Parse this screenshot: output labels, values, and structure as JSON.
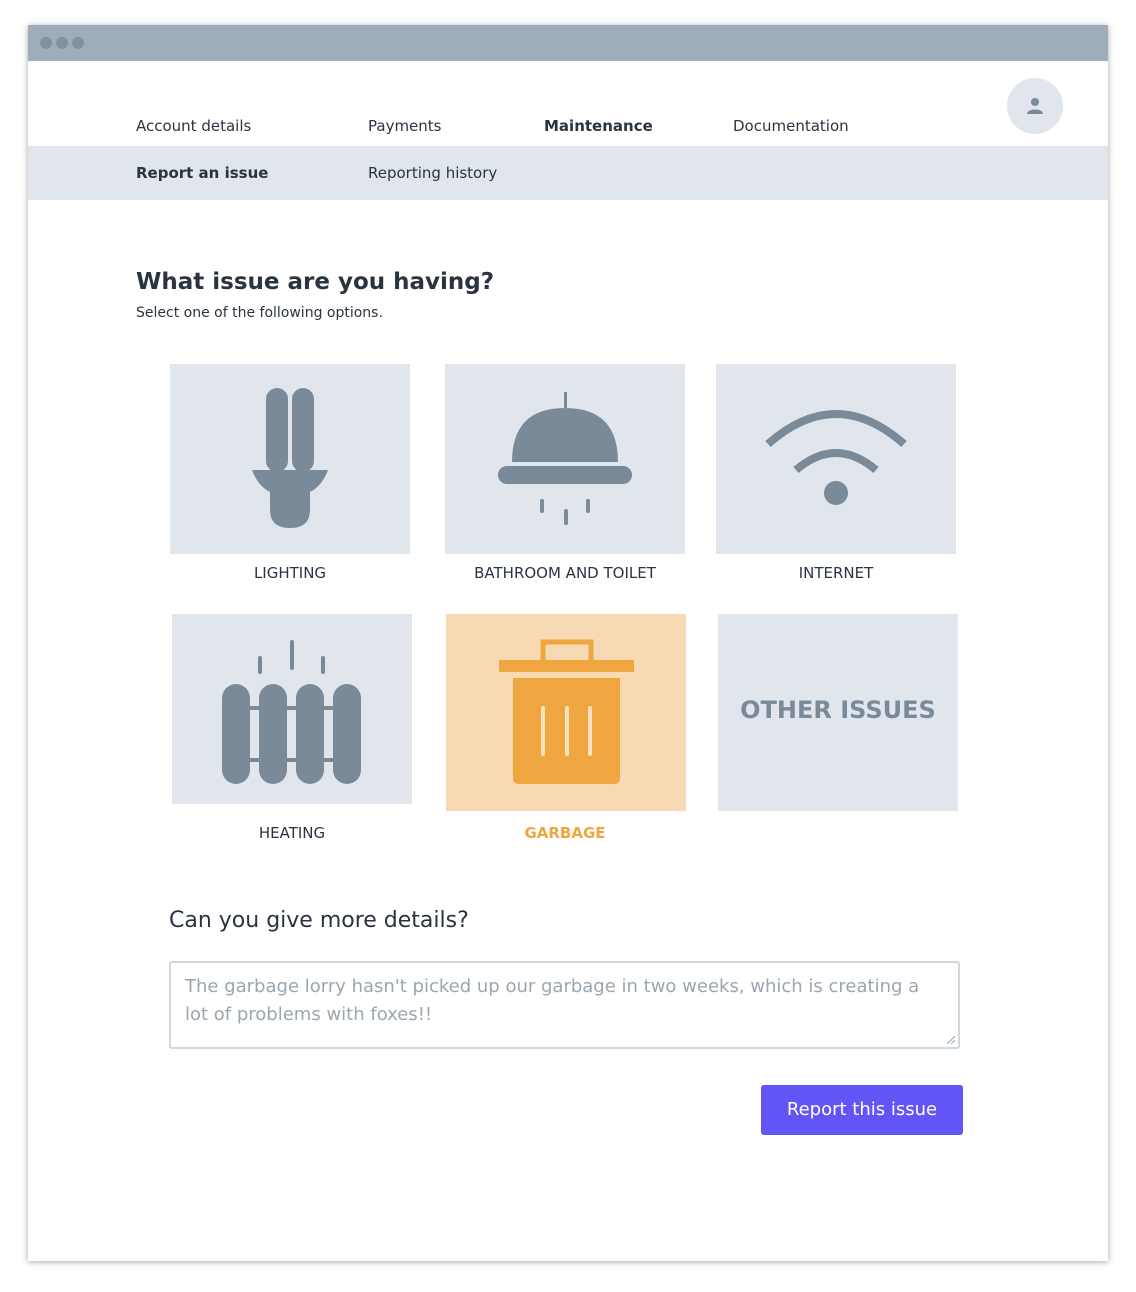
{
  "nav": {
    "items": [
      {
        "label": "Account details",
        "active": false
      },
      {
        "label": "Payments",
        "active": false
      },
      {
        "label": "Maintenance",
        "active": true
      },
      {
        "label": "Documentation",
        "active": false
      }
    ],
    "avatar_icon": "user-icon"
  },
  "subnav": {
    "items": [
      {
        "label": "Report an issue",
        "active": true
      },
      {
        "label": "Reporting history",
        "active": false
      }
    ]
  },
  "main": {
    "heading": "What issue are you having?",
    "subheading": "Select one of the following options.",
    "options": [
      {
        "label": "LIGHTING",
        "icon": "lightbulb-icon",
        "selected": false
      },
      {
        "label": "BATHROOM AND TOILET",
        "icon": "shower-icon",
        "selected": false
      },
      {
        "label": "INTERNET",
        "icon": "wifi-icon",
        "selected": false
      },
      {
        "label": "HEATING",
        "icon": "radiator-icon",
        "selected": false
      },
      {
        "label": "GARBAGE",
        "icon": "trash-icon",
        "selected": true
      },
      {
        "label": "OTHER ISSUES",
        "icon": "",
        "selected": false
      }
    ],
    "details_label": "Can you give more details?",
    "details_value": "The garbage lorry hasn't picked up our garbage in two weeks, which is creating a lot of problems with foxes!!",
    "submit_label": "Report this issue"
  },
  "colors": {
    "accent": "#6355f5",
    "selected": "#f0a640",
    "selected_bg": "#f7dab4",
    "tile_bg": "#e0e6ec",
    "icon": "#7a8a99"
  }
}
